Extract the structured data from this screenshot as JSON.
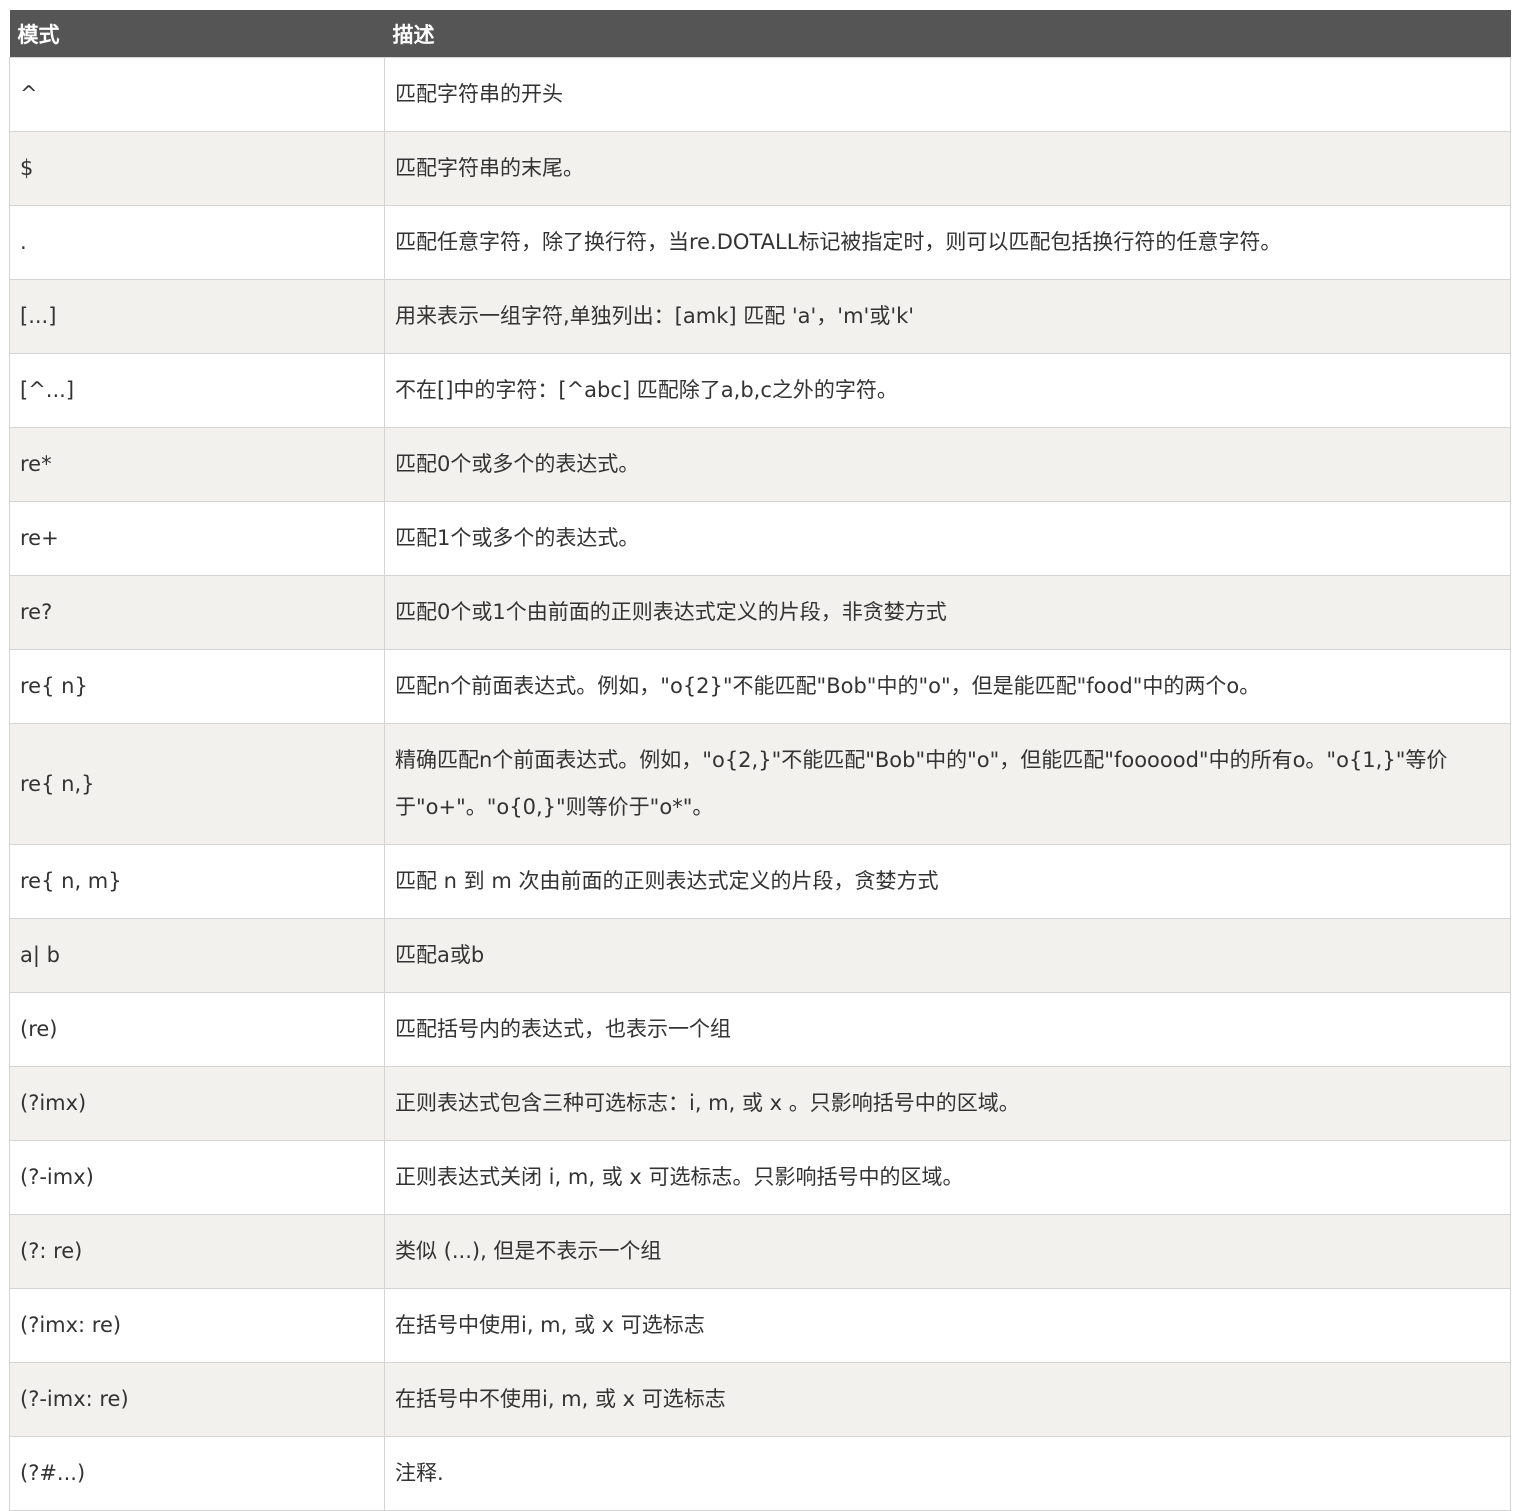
{
  "table": {
    "headers": {
      "pattern": "模式",
      "description": "描述"
    },
    "rows": [
      {
        "pattern": "^",
        "description": "匹配字符串的开头"
      },
      {
        "pattern": "$",
        "description": "匹配字符串的末尾。"
      },
      {
        "pattern": ".",
        "description": "匹配任意字符，除了换行符，当re.DOTALL标记被指定时，则可以匹配包括换行符的任意字符。"
      },
      {
        "pattern": "[...]",
        "description": "用来表示一组字符,单独列出：[amk] 匹配 'a'，'m'或'k'"
      },
      {
        "pattern": "[^...]",
        "description": "不在[]中的字符：[^abc] 匹配除了a,b,c之外的字符。"
      },
      {
        "pattern": "re*",
        "description": "匹配0个或多个的表达式。"
      },
      {
        "pattern": "re+",
        "description": "匹配1个或多个的表达式。"
      },
      {
        "pattern": "re?",
        "description": "匹配0个或1个由前面的正则表达式定义的片段，非贪婪方式"
      },
      {
        "pattern": "re{ n}",
        "description": "匹配n个前面表达式。例如，\"o{2}\"不能匹配\"Bob\"中的\"o\"，但是能匹配\"food\"中的两个o。"
      },
      {
        "pattern": "re{ n,}",
        "description": "精确匹配n个前面表达式。例如，\"o{2,}\"不能匹配\"Bob\"中的\"o\"，但能匹配\"foooood\"中的所有o。\"o{1,}\"等价于\"o+\"。\"o{0,}\"则等价于\"o*\"。"
      },
      {
        "pattern": "re{ n, m}",
        "description": "匹配 n 到 m 次由前面的正则表达式定义的片段，贪婪方式"
      },
      {
        "pattern": "a| b",
        "description": "匹配a或b"
      },
      {
        "pattern": "(re)",
        "description": "匹配括号内的表达式，也表示一个组"
      },
      {
        "pattern": "(?imx)",
        "description": "正则表达式包含三种可选标志：i, m, 或 x 。只影响括号中的区域。"
      },
      {
        "pattern": "(?-imx)",
        "description": "正则表达式关闭 i, m, 或 x 可选标志。只影响括号中的区域。"
      },
      {
        "pattern": "(?: re)",
        "description": "类似 (...), 但是不表示一个组"
      },
      {
        "pattern": "(?imx: re)",
        "description": "在括号中使用i, m, 或 x 可选标志"
      },
      {
        "pattern": "(?-imx: re)",
        "description": "在括号中不使用i, m, 或 x 可选标志"
      },
      {
        "pattern": "(?#...)",
        "description": "注释."
      }
    ]
  }
}
